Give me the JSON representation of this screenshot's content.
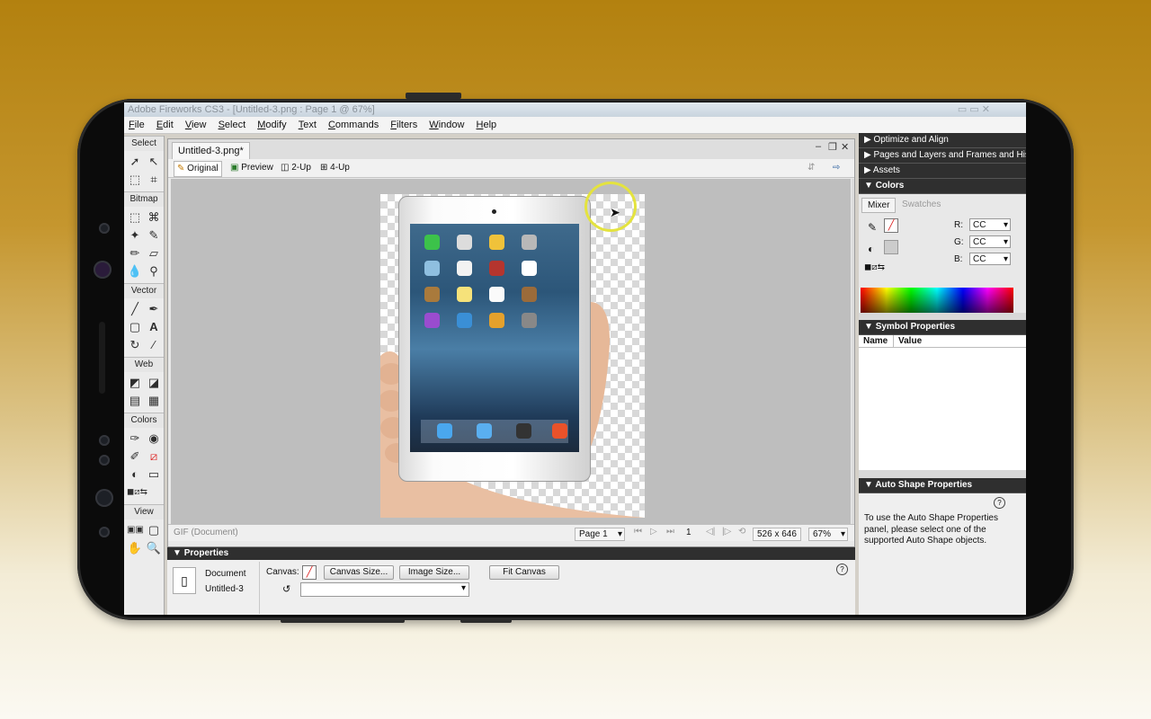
{
  "app": {
    "title": "Adobe Fireworks CS3 - [Untitled-3.png : Page 1 @ 67%]"
  },
  "menu": [
    "File",
    "Edit",
    "View",
    "Select",
    "Modify",
    "Text",
    "Commands",
    "Filters",
    "Window",
    "Help"
  ],
  "tools": {
    "sections": [
      "Select",
      "Bitmap",
      "Vector",
      "Web",
      "Colors",
      "View"
    ]
  },
  "document": {
    "tab_label": "Untitled-3.png*",
    "view_modes": [
      "Original",
      "Preview",
      "2-Up",
      "4-Up"
    ],
    "status": {
      "format": "GIF (Document)",
      "page_select": "Page 1",
      "page_number": "1",
      "dimensions": "526 x 646",
      "zoom": "67%"
    }
  },
  "properties": {
    "title": "Properties",
    "doc_label": "Document",
    "doc_name": "Untitled-3",
    "canvas_label": "Canvas:",
    "buttons": {
      "canvas_size": "Canvas Size...",
      "image_size": "Image Size...",
      "fit_canvas": "Fit Canvas"
    }
  },
  "panels": {
    "optimize": "Optimize and Align",
    "pages": "Pages and Layers and Frames and History",
    "assets": "Assets",
    "colors": "Colors",
    "mixer_tab": "Mixer",
    "swatches_tab": "Swatches",
    "r_label": "R:",
    "g_label": "G:",
    "b_label": "B:",
    "r_val": "CC",
    "g_val": "CC",
    "b_val": "CC",
    "symbol_props": "Symbol Properties",
    "col_name": "Name",
    "col_value": "Value",
    "auto_shape": "Auto Shape Properties",
    "auto_shape_msg": "To use the Auto Shape Properties panel, please select one of the supported Auto Shape objects."
  },
  "colors": {
    "bg_top": "#b3810f",
    "panel_header": "#2f2f2f",
    "highlight_ring": "#e4e33f"
  }
}
